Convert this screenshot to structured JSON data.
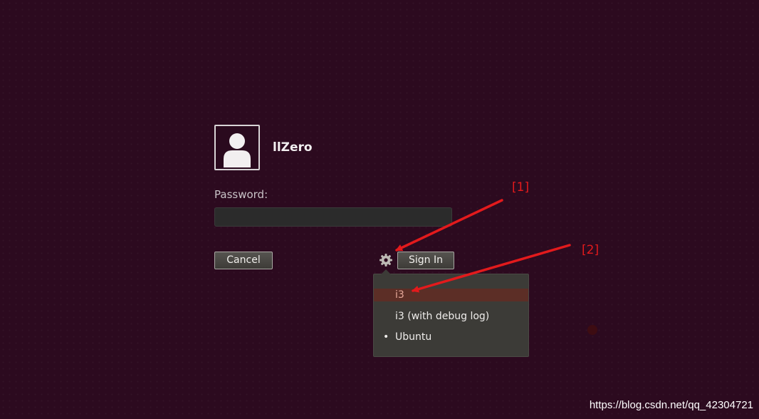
{
  "user": {
    "name": "llZero",
    "avatar_icon": "person-icon"
  },
  "login": {
    "password_label": "Password:",
    "password_value": "",
    "cancel_label": "Cancel",
    "signin_label": "Sign In",
    "gear_icon": "gear-icon"
  },
  "session_menu": {
    "items": [
      {
        "label": "i3",
        "selected": true,
        "active": false
      },
      {
        "label": "i3 (with debug log)",
        "selected": false,
        "active": false
      },
      {
        "label": "Ubuntu",
        "selected": false,
        "active": true,
        "bullet": "•"
      }
    ]
  },
  "annotations": {
    "label_1": "[1]",
    "label_2": "[2]",
    "color": "#e31a1c"
  },
  "watermark": "https://blog.csdn.net/qq_42304721",
  "colors": {
    "background": "#2c0a1f",
    "menu_background": "#3c3b37",
    "selected_item": "#5c2e26"
  }
}
